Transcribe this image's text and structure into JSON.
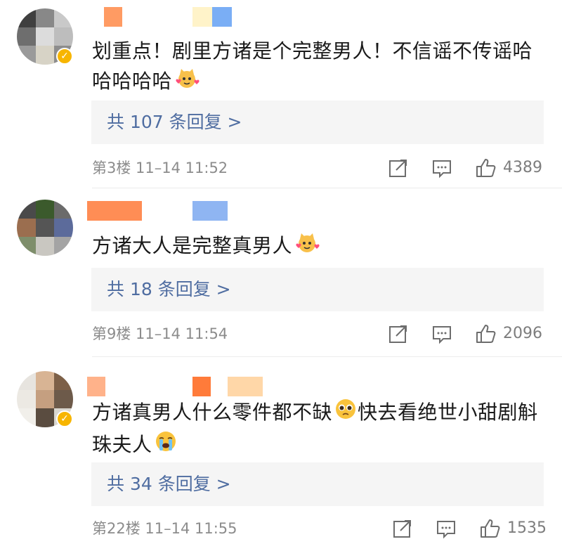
{
  "comments": [
    {
      "text": "划重点！剧里方诸是个完整男人！不信谣不传谣哈哈哈哈哈",
      "emoji": "cat-love-emoji",
      "replies_label": "共 107 条回复 >",
      "meta": "第3楼  11–14  11:52",
      "likes": "4389",
      "verified": true
    },
    {
      "text": "方诸大人是完整真男人",
      "emoji": "cat-love-emoji",
      "replies_label": "共 18 条回复 >",
      "meta": "第9楼  11–14  11:54",
      "likes": "2096",
      "verified": false
    },
    {
      "text": "方诸真男人什么零件都不缺快去看绝世小甜剧斛珠夫人",
      "emoji": "pleading-face-emoji, crying-face-emoji",
      "replies_label": "共 34 条回复 >",
      "meta": "第22楼  11–14  11:55",
      "likes": "1535",
      "verified": true
    }
  ],
  "icons": {
    "share": "share-icon",
    "comment": "comment-icon",
    "like": "thumbs-up-icon",
    "verified": "verified-badge-icon"
  },
  "colors": {
    "reply_link": "#4f6da1",
    "reply_bg": "#f5f5f5",
    "meta_text": "#8c8c8c",
    "body_text": "#1a1a1a",
    "verified_badge": "#f7b500"
  }
}
